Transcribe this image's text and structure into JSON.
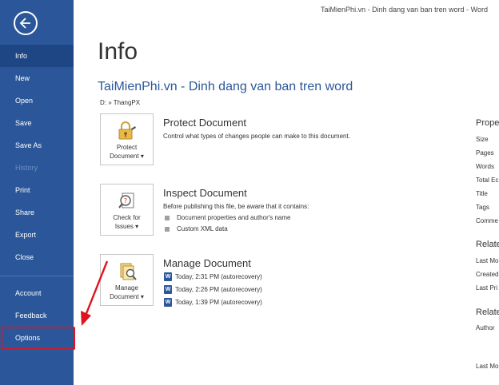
{
  "window": {
    "title": "TaiMienPhi.vn - Dinh dang van ban tren word  -  Word"
  },
  "sidebar": {
    "items": [
      {
        "label": "Info"
      },
      {
        "label": "New"
      },
      {
        "label": "Open"
      },
      {
        "label": "Save"
      },
      {
        "label": "Save As"
      },
      {
        "label": "History"
      },
      {
        "label": "Print"
      },
      {
        "label": "Share"
      },
      {
        "label": "Export"
      },
      {
        "label": "Close"
      },
      {
        "label": "Account"
      },
      {
        "label": "Feedback"
      },
      {
        "label": "Options"
      }
    ]
  },
  "main": {
    "page_title": "Info",
    "doc_title": "TaiMienPhi.vn - Dinh dang van ban tren word",
    "doc_path": "D: » ThangPX",
    "protect": {
      "button_line1": "Protect",
      "button_line2": "Document ▾",
      "title": "Protect Document",
      "desc": "Control what types of changes people can make to this document."
    },
    "inspect": {
      "button_line1": "Check for",
      "button_line2": "Issues ▾",
      "title": "Inspect Document",
      "desc": "Before publishing this file, be aware that it contains:",
      "bullets": [
        "Document properties and author's name",
        "Custom XML data"
      ]
    },
    "manage": {
      "button_line1": "Manage",
      "button_line2": "Document ▾",
      "title": "Manage Document",
      "versions": [
        "Today, 2:31 PM (autorecovery)",
        "Today, 2:26 PM (autorecovery)",
        "Today, 1:39 PM (autorecovery)"
      ]
    }
  },
  "properties": {
    "heading": "Prope",
    "labels": [
      "Size",
      "Pages",
      "Words",
      "Total Ec",
      "Title",
      "Tags",
      "Comme"
    ],
    "related_dates_heading": "Relate",
    "dates": [
      "Last Mo",
      "Created",
      "Last Pri"
    ],
    "related_people_heading": "Relate",
    "people": [
      "Author"
    ],
    "last_modified_by": "Last Mo"
  },
  "colors": {
    "sidebar": "#2b579a",
    "accent": "#2b579a",
    "highlight": "#e0141e"
  }
}
